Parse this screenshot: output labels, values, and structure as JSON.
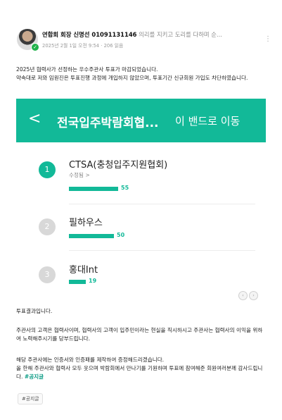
{
  "post": {
    "author_name": "연합회 회장 신명선 01091131146",
    "author_desc": "의리를 지키고 도리를 다하며 순...",
    "meta": "2025년 2월 1일 오전 9:54 · 206 읽음",
    "more_icon": "⋮"
  },
  "intro": {
    "line1": "2025년 협력사가 선정하는 우수주관사 투표가 마감되었습니다.",
    "line2": "약속대로 저와 임원진은 투표진행 과정에 개입하지 않았으며, 투표기간 신규회원 가입도 차단하였습니다."
  },
  "band": {
    "back_icon": "<",
    "title": "전국입주박람회협...",
    "go_label": "이 밴드로 이동",
    "color": "#12b998"
  },
  "vote": {
    "options": [
      {
        "rank": "1",
        "name": "CTSA(충청입주지원협회)",
        "sub": "수정됨 >",
        "count": 55
      },
      {
        "rank": "2",
        "name": "필하우스",
        "sub": "",
        "count": 50
      },
      {
        "rank": "3",
        "name": "홍대Int",
        "sub": "",
        "count": 19
      }
    ]
  },
  "body": {
    "result": "투표결과입니다.",
    "para1": "주관사의 고객은 협력사이며, 협력사의 고객이 입주민이라는 현실을 직시하시고 주관사는 협력사의 이익을  위하여  노력해주시기를 당부드립니다.",
    "para2_line1": "해당 주관사에는 인증서와 인증패를 제작하여 증정해드리겠습니다.",
    "para2_line2": "올 한해 주관사와 협력사  모두 웃으며  박람회에서 만나기를 기원하며  투표에 참여해준 회원여러분께 감사드립니다. ",
    "para2_tag": "#공지글"
  },
  "tag_chip": "#공지글"
}
